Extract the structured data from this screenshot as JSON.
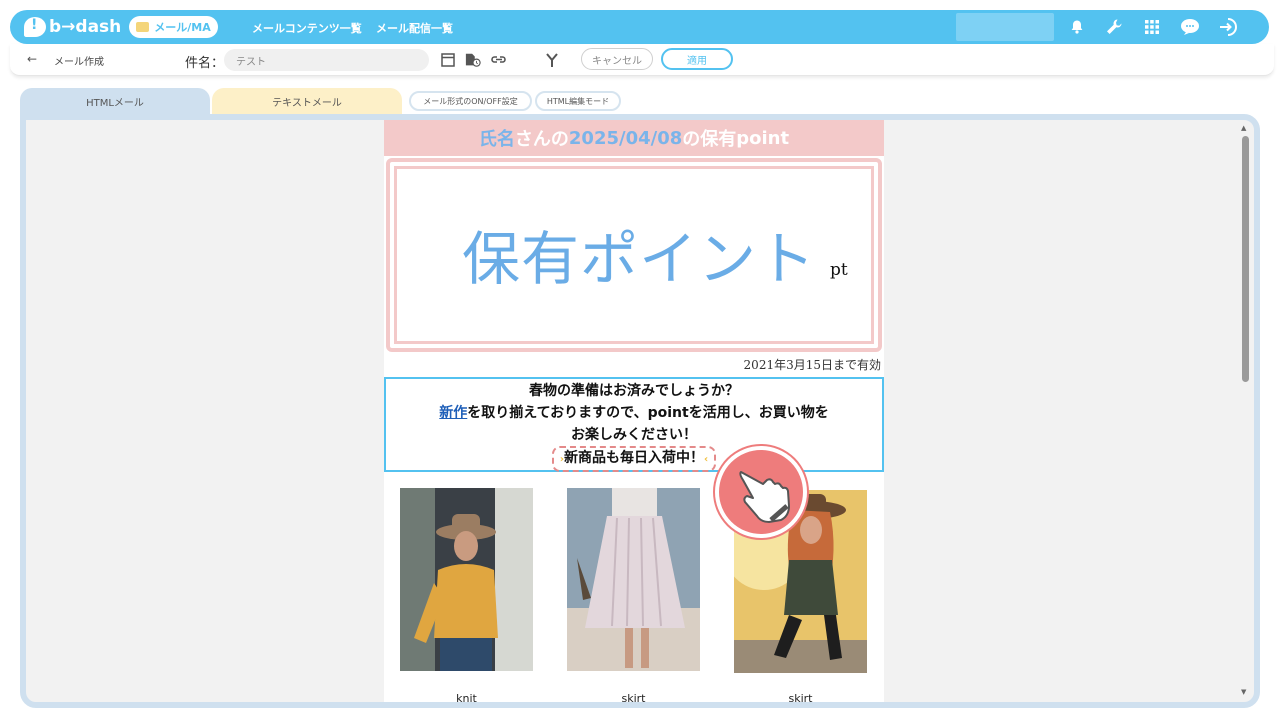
{
  "app": {
    "logo_text": "b→dash",
    "module_pill": "メール/MA",
    "nav_links": [
      "メールコンテンツ一覧",
      "メール配信一覧"
    ],
    "icons": [
      "bell-icon",
      "wrench-icon",
      "grid-icon",
      "faq-icon",
      "logout-icon"
    ]
  },
  "toolbar": {
    "back_label": "←",
    "page_label": "メール作成",
    "subject_label": "件名：",
    "subject_value": "テスト",
    "cancel_label": "キャンセル",
    "apply_label": "適用"
  },
  "tabs": {
    "html_tab": "HTMLメール",
    "text_tab": "テキストメール",
    "format_toggle": "メール形式のON/OFF設定",
    "html_edit_mode": "HTML編集モード"
  },
  "email": {
    "header_pre": "氏名",
    "header_mid1": "さんの",
    "header_date": "2025/04/08",
    "header_mid2": "の保有",
    "header_point": "point",
    "point_title": "保有ポイント",
    "point_unit": "pt",
    "valid_until": "2021年3月15日まで有効",
    "msg_line1": "春物の準備はお済みでしょうか？",
    "msg_link": "新作",
    "msg_line2": "を取り揃えておりますので、pointを活用し、お買い物を",
    "msg_line3": "お楽しみください！",
    "msg_arrival": "新商品も毎日入荷中！",
    "products": [
      {
        "label": "knit"
      },
      {
        "label": "skirt"
      },
      {
        "label": "skirt"
      }
    ]
  },
  "colors": {
    "brand": "#53c2f0",
    "accent_pink": "#f3c9c9",
    "point_blue": "#6aace6",
    "pointer_red": "#ee7c7c"
  }
}
